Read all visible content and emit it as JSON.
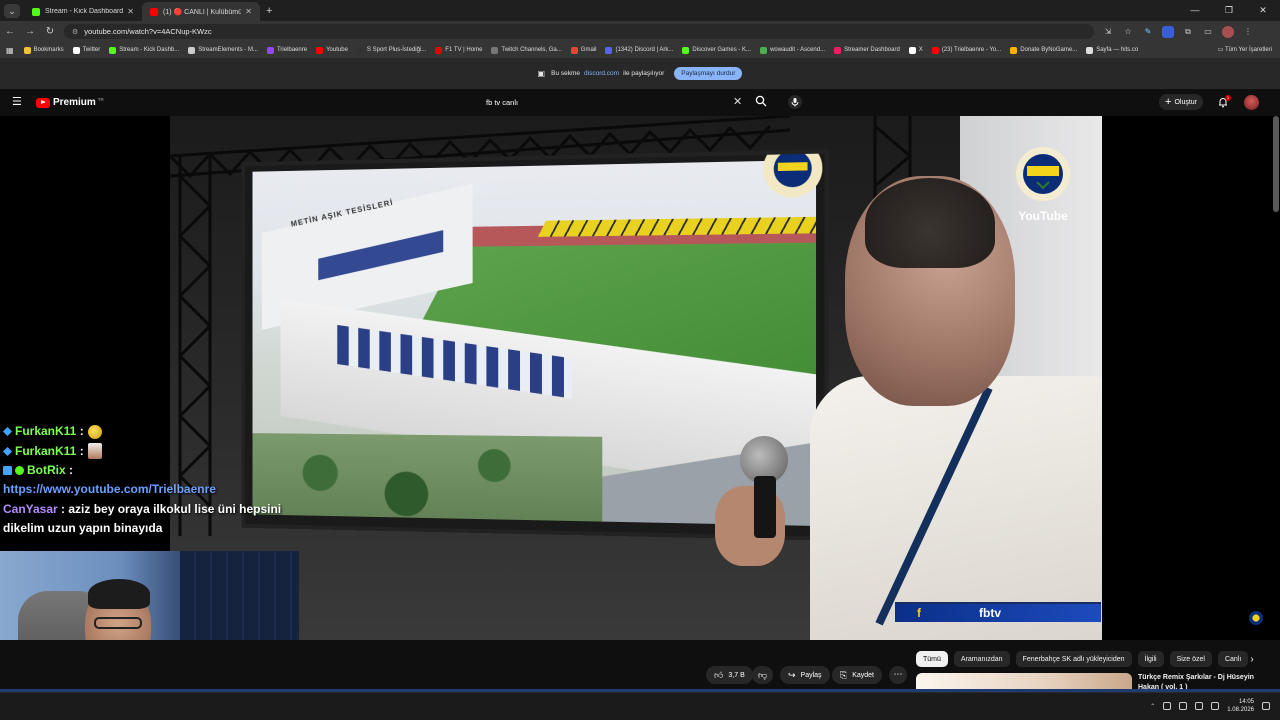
{
  "browser": {
    "tabs": [
      {
        "title": "Stream - Kick Dashboard",
        "color": "#53fc18",
        "active": false
      },
      {
        "title": "(1) 🔴 CANLI | Kulübümüzün ...",
        "color": "#ff0000",
        "active": true
      }
    ],
    "url": "youtube.com/watch?v=4ACNup-KWzc",
    "bookmarks": [
      {
        "label": "Bookmarks",
        "color": "#f1c232"
      },
      {
        "label": "Twitter",
        "color": "#ffffff"
      },
      {
        "label": "Stream - Kick Dashb...",
        "color": "#53fc18"
      },
      {
        "label": "StreamElements - M...",
        "color": "#cccccc"
      },
      {
        "label": "Trielbaenre",
        "color": "#9146ff"
      },
      {
        "label": "Youtube",
        "color": "#ff0000"
      },
      {
        "label": "S Sport Plus-İstediği...",
        "color": "#333333"
      },
      {
        "label": "F1 TV | Home",
        "color": "#e10600"
      },
      {
        "label": "Twitch Channels, Ga...",
        "color": "#777777"
      },
      {
        "label": "Gmail",
        "color": "#ea4335"
      },
      {
        "label": "(1342) Discord | Ark...",
        "color": "#5865f2"
      },
      {
        "label": "Discover Games - K...",
        "color": "#53fc18"
      },
      {
        "label": "wowaudit - Ascend...",
        "color": "#4caf50"
      },
      {
        "label": "Streamer Dashboard",
        "color": "#e91e63"
      },
      {
        "label": "X",
        "color": "#ffffff"
      },
      {
        "label": "(23) Trielbaenre - Yo...",
        "color": "#ff0000"
      },
      {
        "label": "Donate ByNoGame...",
        "color": "#ffb300"
      },
      {
        "label": "Sayfa — hits.co",
        "color": "#dddddd"
      }
    ],
    "bookmarks_right": "Tüm Yer İşaretleri",
    "share_notice": {
      "prefix": "Bu sekme",
      "host": "discord.com",
      "suffix": "ile paylaşılıyor",
      "button": "Paylaşmayı durdur"
    }
  },
  "youtube": {
    "logo_text": "Premium",
    "country_code": "TR",
    "search_value": "fb tv canlı",
    "create_label": "Oluştur",
    "notif_count": "1"
  },
  "video": {
    "watermark": "YouTube",
    "screen_sign": "METİN AŞIK TESİSLERİ",
    "lower_third": "fbtv"
  },
  "chat": [
    {
      "user": "FurkanK11",
      "sep": ":",
      "type": "emote1"
    },
    {
      "user": "FurkanK11",
      "sep": ":",
      "type": "emote2"
    },
    {
      "user": "BotRix",
      "sep": ":",
      "type": "bot"
    }
  ],
  "chat_link": "https://www.youtube.com/Trielbaenre",
  "chat_msg": {
    "user": "CanYasar",
    "text_line1": ": aziz bey oraya ilkokul lise üni hepsini",
    "text_line2": "dikelim uzun yapın binayıda"
  },
  "actions": {
    "likes": "3,7 B",
    "share": "Paylaş",
    "save": "Kaydet"
  },
  "chips": [
    "Tümü",
    "Aramanızdan",
    "Fenerbahçe SK adlı yükleyiciden",
    "İlgili",
    "Size özel",
    "Canlı"
  ],
  "recommendation": {
    "title": "Türkçe Remix Şarkılar - Dj Hüseyin Hakan ( vol. 1 )"
  },
  "taskbar": {
    "time": "14:05",
    "date": "1.08.2026"
  }
}
